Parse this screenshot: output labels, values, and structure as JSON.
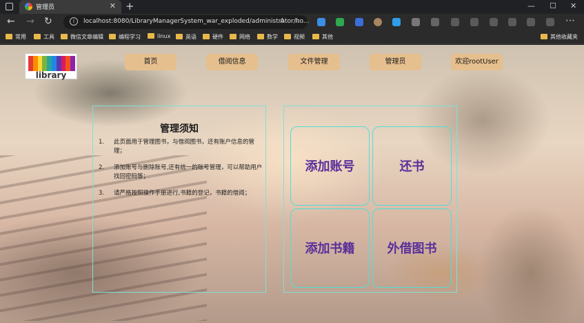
{
  "browser": {
    "tab_title": "管理员",
    "url": "localhost:8080/LibraryManagerSystem_war_exploded/administrator/ho...",
    "bookmarks": [
      "常用",
      "工具",
      "微信文章编辑",
      "编程学习",
      "linux",
      "英语",
      "硬件",
      "网络",
      "数学",
      "视频",
      "其他"
    ],
    "other_bookmarks": "其他收藏夹"
  },
  "logo": {
    "text": "library"
  },
  "nav": {
    "home": "首页",
    "borrow_info": "借阅信息",
    "file_mgmt": "文件管理",
    "admin": "管理员",
    "welcome": "欢迎rootUser"
  },
  "notice": {
    "title": "管理须知",
    "items": [
      {
        "num": "1.",
        "text": "此页面用于管理图书，与借阅图书，还有账户信息的管理；"
      },
      {
        "num": "2.",
        "text": "添加账号与删除账号,还有统一的账号管理，可以帮助用户找回密码等；"
      },
      {
        "num": "3.",
        "text": "请严格按照操作手册进行,书籍的登记，书籍的借阅；"
      }
    ]
  },
  "actions": {
    "add_account": "添加账号",
    "return_book": "还书",
    "add_book": "添加书籍",
    "lend_book": "外借图书"
  },
  "colors": {
    "nav_button": "#e6bf8e",
    "border_accent": "#7fe0d8",
    "action_text": "#5a2e9a"
  }
}
